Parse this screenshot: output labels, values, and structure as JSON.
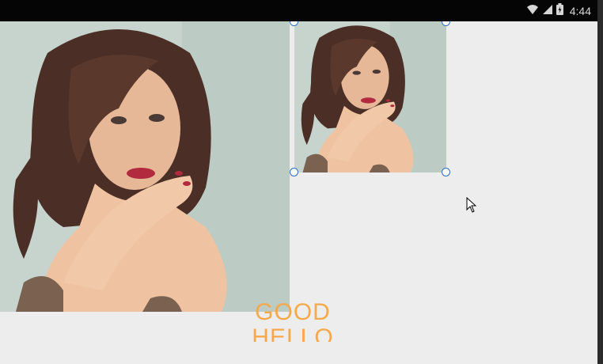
{
  "status_bar": {
    "time": "4:44",
    "icons": [
      "wifi-icon",
      "cell-signal-icon",
      "battery-icon"
    ]
  },
  "canvas": {
    "texts": [
      "GOOD",
      "HELLO"
    ],
    "text_color": "#f5a94a",
    "background": "#ededed"
  },
  "colors": {
    "selection_handle": "#2a6fc9"
  }
}
